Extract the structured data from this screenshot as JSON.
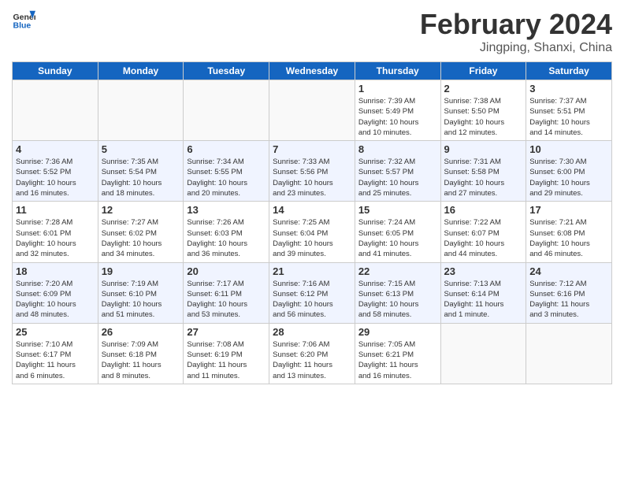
{
  "header": {
    "title": "February 2024",
    "subtitle": "Jingping, Shanxi, China"
  },
  "calendar": {
    "days": [
      "Sunday",
      "Monday",
      "Tuesday",
      "Wednesday",
      "Thursday",
      "Friday",
      "Saturday"
    ]
  },
  "rows": [
    [
      {
        "num": "",
        "info": ""
      },
      {
        "num": "",
        "info": ""
      },
      {
        "num": "",
        "info": ""
      },
      {
        "num": "",
        "info": ""
      },
      {
        "num": "1",
        "info": "Sunrise: 7:39 AM\nSunset: 5:49 PM\nDaylight: 10 hours\nand 10 minutes."
      },
      {
        "num": "2",
        "info": "Sunrise: 7:38 AM\nSunset: 5:50 PM\nDaylight: 10 hours\nand 12 minutes."
      },
      {
        "num": "3",
        "info": "Sunrise: 7:37 AM\nSunset: 5:51 PM\nDaylight: 10 hours\nand 14 minutes."
      }
    ],
    [
      {
        "num": "4",
        "info": "Sunrise: 7:36 AM\nSunset: 5:52 PM\nDaylight: 10 hours\nand 16 minutes."
      },
      {
        "num": "5",
        "info": "Sunrise: 7:35 AM\nSunset: 5:54 PM\nDaylight: 10 hours\nand 18 minutes."
      },
      {
        "num": "6",
        "info": "Sunrise: 7:34 AM\nSunset: 5:55 PM\nDaylight: 10 hours\nand 20 minutes."
      },
      {
        "num": "7",
        "info": "Sunrise: 7:33 AM\nSunset: 5:56 PM\nDaylight: 10 hours\nand 23 minutes."
      },
      {
        "num": "8",
        "info": "Sunrise: 7:32 AM\nSunset: 5:57 PM\nDaylight: 10 hours\nand 25 minutes."
      },
      {
        "num": "9",
        "info": "Sunrise: 7:31 AM\nSunset: 5:58 PM\nDaylight: 10 hours\nand 27 minutes."
      },
      {
        "num": "10",
        "info": "Sunrise: 7:30 AM\nSunset: 6:00 PM\nDaylight: 10 hours\nand 29 minutes."
      }
    ],
    [
      {
        "num": "11",
        "info": "Sunrise: 7:28 AM\nSunset: 6:01 PM\nDaylight: 10 hours\nand 32 minutes."
      },
      {
        "num": "12",
        "info": "Sunrise: 7:27 AM\nSunset: 6:02 PM\nDaylight: 10 hours\nand 34 minutes."
      },
      {
        "num": "13",
        "info": "Sunrise: 7:26 AM\nSunset: 6:03 PM\nDaylight: 10 hours\nand 36 minutes."
      },
      {
        "num": "14",
        "info": "Sunrise: 7:25 AM\nSunset: 6:04 PM\nDaylight: 10 hours\nand 39 minutes."
      },
      {
        "num": "15",
        "info": "Sunrise: 7:24 AM\nSunset: 6:05 PM\nDaylight: 10 hours\nand 41 minutes."
      },
      {
        "num": "16",
        "info": "Sunrise: 7:22 AM\nSunset: 6:07 PM\nDaylight: 10 hours\nand 44 minutes."
      },
      {
        "num": "17",
        "info": "Sunrise: 7:21 AM\nSunset: 6:08 PM\nDaylight: 10 hours\nand 46 minutes."
      }
    ],
    [
      {
        "num": "18",
        "info": "Sunrise: 7:20 AM\nSunset: 6:09 PM\nDaylight: 10 hours\nand 48 minutes."
      },
      {
        "num": "19",
        "info": "Sunrise: 7:19 AM\nSunset: 6:10 PM\nDaylight: 10 hours\nand 51 minutes."
      },
      {
        "num": "20",
        "info": "Sunrise: 7:17 AM\nSunset: 6:11 PM\nDaylight: 10 hours\nand 53 minutes."
      },
      {
        "num": "21",
        "info": "Sunrise: 7:16 AM\nSunset: 6:12 PM\nDaylight: 10 hours\nand 56 minutes."
      },
      {
        "num": "22",
        "info": "Sunrise: 7:15 AM\nSunset: 6:13 PM\nDaylight: 10 hours\nand 58 minutes."
      },
      {
        "num": "23",
        "info": "Sunrise: 7:13 AM\nSunset: 6:14 PM\nDaylight: 11 hours\nand 1 minute."
      },
      {
        "num": "24",
        "info": "Sunrise: 7:12 AM\nSunset: 6:16 PM\nDaylight: 11 hours\nand 3 minutes."
      }
    ],
    [
      {
        "num": "25",
        "info": "Sunrise: 7:10 AM\nSunset: 6:17 PM\nDaylight: 11 hours\nand 6 minutes."
      },
      {
        "num": "26",
        "info": "Sunrise: 7:09 AM\nSunset: 6:18 PM\nDaylight: 11 hours\nand 8 minutes."
      },
      {
        "num": "27",
        "info": "Sunrise: 7:08 AM\nSunset: 6:19 PM\nDaylight: 11 hours\nand 11 minutes."
      },
      {
        "num": "28",
        "info": "Sunrise: 7:06 AM\nSunset: 6:20 PM\nDaylight: 11 hours\nand 13 minutes."
      },
      {
        "num": "29",
        "info": "Sunrise: 7:05 AM\nSunset: 6:21 PM\nDaylight: 11 hours\nand 16 minutes."
      },
      {
        "num": "",
        "info": ""
      },
      {
        "num": "",
        "info": ""
      }
    ]
  ]
}
